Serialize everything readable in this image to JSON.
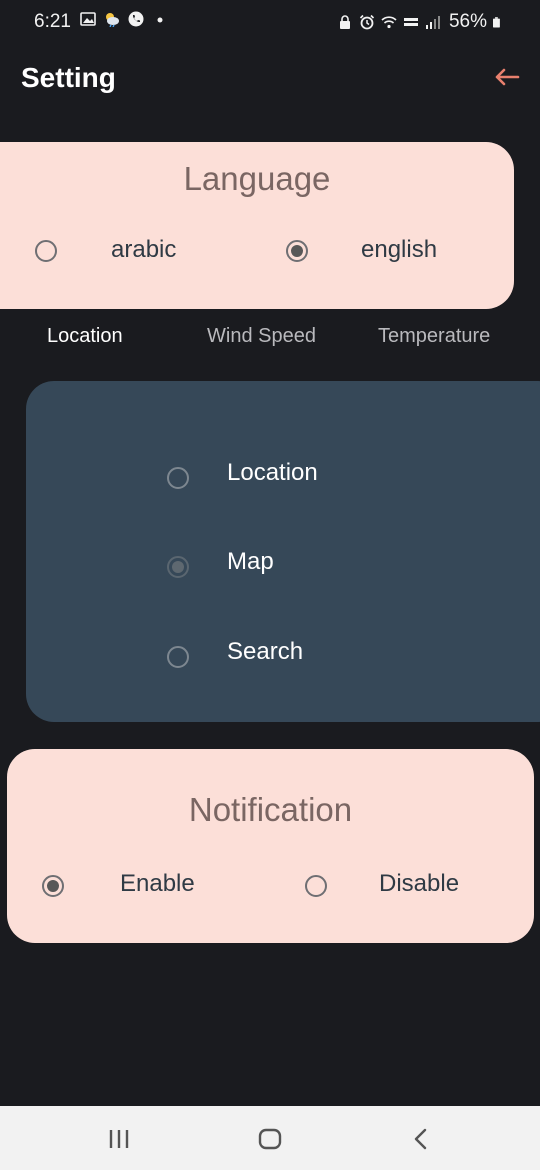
{
  "status_bar": {
    "time": "6:21",
    "battery": "56%",
    "left_icons": [
      "gallery-icon",
      "weather-icon",
      "phone-call-icon",
      "dot-icon"
    ],
    "right_icons": [
      "lock-icon",
      "alarm-icon",
      "wifi-icon",
      "volte-icon",
      "signal-icon",
      "battery-icon"
    ]
  },
  "app_bar": {
    "title": "Setting",
    "back_icon": "arrow-left-icon",
    "accent_color": "#e8806e"
  },
  "language": {
    "title": "Language",
    "options": [
      {
        "label": "arabic",
        "selected": false
      },
      {
        "label": "english",
        "selected": true
      }
    ]
  },
  "tabs": [
    {
      "label": "Location",
      "active": true
    },
    {
      "label": "Wind Speed",
      "active": false
    },
    {
      "label": "Temperature",
      "active": false
    }
  ],
  "location_options": [
    {
      "label": "Location",
      "selected": false
    },
    {
      "label": "Map",
      "selected": true
    },
    {
      "label": "Search",
      "selected": false
    }
  ],
  "notification": {
    "title": "Notification",
    "options": [
      {
        "label": "Enable",
        "selected": true
      },
      {
        "label": "Disable",
        "selected": false
      }
    ]
  },
  "nav_bar": {
    "icons": [
      "recent-apps-icon",
      "home-icon",
      "back-icon"
    ]
  },
  "colors": {
    "background": "#1a1b1f",
    "pink_card": "#fcdfd8",
    "dark_card": "#364858"
  }
}
